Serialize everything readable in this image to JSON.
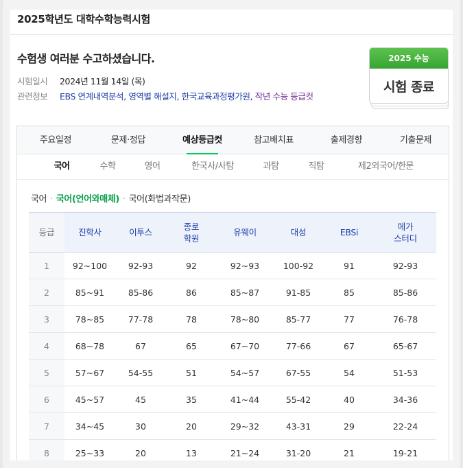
{
  "page_title": "2025학년도 대학수학능력시험",
  "greeting": "수험생 여러분 수고하셨습니다.",
  "info": {
    "date_label": "시험일시",
    "date_value": "2024년 11월 14일 (목)",
    "related_label": "관련정보",
    "links": [
      "EBS 연계내역분석",
      "영역별 해설지",
      "한국교육과정평가원",
      "작년 수능 등급컷"
    ]
  },
  "calendar": {
    "band": "2025 수능",
    "text": "시험 종료"
  },
  "main_tabs": [
    "주요일정",
    "문제·정답",
    "예상등급컷",
    "참고배치표",
    "출제경향",
    "기출문제"
  ],
  "main_tab_active": "예상등급컷",
  "sub_tabs": [
    "국어",
    "수학",
    "영어",
    "한국사/사탐",
    "과탐",
    "직탐",
    "제2외국어/한문"
  ],
  "sub_tab_active": "국어",
  "crumbs": [
    "국어",
    "국어(언어와매체)",
    "국어(화법과작문)"
  ],
  "crumb_active": "국어(언어와매체)",
  "table": {
    "headers": [
      "등급",
      "진학사",
      "이투스",
      "종로\n학원",
      "유웨이",
      "대성",
      "EBSi",
      "메가\n스터디"
    ],
    "rows": [
      [
        "1",
        "92~100",
        "92-93",
        "92",
        "92~93",
        "100-92",
        "91",
        "92-93"
      ],
      [
        "2",
        "85~91",
        "85-86",
        "86",
        "85~87",
        "91-85",
        "85",
        "85-86"
      ],
      [
        "3",
        "78~85",
        "77-78",
        "78",
        "78~80",
        "85-77",
        "77",
        "76-78"
      ],
      [
        "4",
        "68~78",
        "67",
        "65",
        "67~70",
        "77-66",
        "67",
        "65-67"
      ],
      [
        "5",
        "57~67",
        "54-55",
        "51",
        "54~57",
        "67-55",
        "54",
        "51-53"
      ],
      [
        "6",
        "45~57",
        "45",
        "35",
        "41~44",
        "55-42",
        "40",
        "34-36"
      ],
      [
        "7",
        "34~45",
        "30",
        "20",
        "29~32",
        "43-31",
        "29",
        "22-24"
      ],
      [
        "8",
        "25~33",
        "20",
        "13",
        "21~24",
        "31-20",
        "21",
        "19-21"
      ]
    ]
  }
}
